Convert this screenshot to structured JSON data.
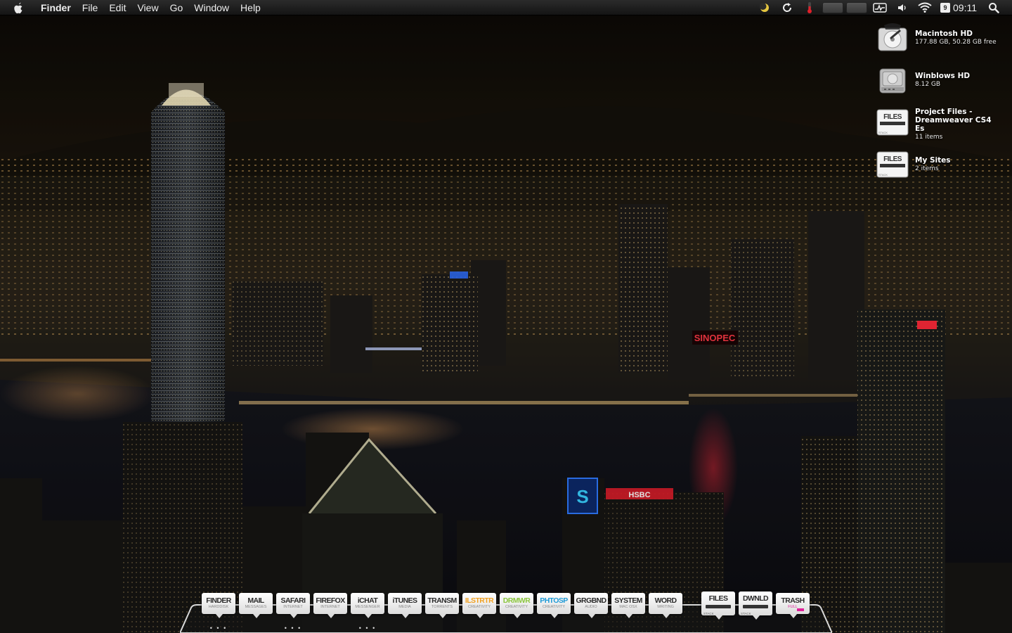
{
  "menubar": {
    "app_name": "Finder",
    "menus": [
      "File",
      "Edit",
      "View",
      "Go",
      "Window",
      "Help"
    ],
    "clock": "09:11",
    "calendar_day": "9",
    "status_icons": [
      "moon-icon",
      "sync-icon",
      "temperature-meter",
      "cpu-meter",
      "memory-meter",
      "activity-monitor-icon",
      "volume-icon",
      "wifi-icon",
      "calendar-icon",
      "spotlight-icon"
    ]
  },
  "desktop_icons": [
    {
      "name": "Macintosh HD",
      "info": "177.88 GB, 50.28 GB free",
      "icon": "hard-drive-icon"
    },
    {
      "name": "Winblows HD",
      "info": "8.12 GB",
      "icon": "hard-drive-icon"
    },
    {
      "name_line1": "Project Files -",
      "name_line2": "Dreamweaver CS4 Es",
      "info": "11 items",
      "icon": "files-stack-icon",
      "label": "FILES",
      "sublabel": "STACK"
    },
    {
      "name": "My Sites",
      "info": "2 items",
      "icon": "files-stack-icon",
      "label": "FILES",
      "sublabel": "STACK"
    }
  ],
  "dock": {
    "apps": [
      {
        "label": "FINDER",
        "sub": "HARDDISK",
        "color": "#2a2a2a",
        "running": true
      },
      {
        "label": "MAIL",
        "sub": "MESSAGES",
        "color": "#2a2a2a",
        "running": false
      },
      {
        "label": "SAFARI",
        "sub": "INTERNET",
        "color": "#2a2a2a",
        "running": true
      },
      {
        "label": "FIREFOX",
        "sub": "INTERNET",
        "color": "#2a2a2a",
        "running": false
      },
      {
        "label": "iCHAT",
        "sub": "MESSENGER",
        "color": "#2a2a2a",
        "running": true
      },
      {
        "label": "iTUNES",
        "sub": "MEDIA",
        "color": "#2a2a2a",
        "running": false
      },
      {
        "label": "TRANSM",
        "sub": "TORRENTS",
        "color": "#2a2a2a",
        "running": false
      },
      {
        "label": "ILSTRTR",
        "sub": "CREATIVITY",
        "color": "#f0a020",
        "running": false
      },
      {
        "label": "DRMWR",
        "sub": "CREATIVITY",
        "color": "#8cc63f",
        "running": false
      },
      {
        "label": "PHTOSP",
        "sub": "CREATIVITY",
        "color": "#1e9ad6",
        "running": false
      },
      {
        "label": "GRGBND",
        "sub": "AUDIO",
        "color": "#2a2a2a",
        "running": false
      },
      {
        "label": "SYSTEM",
        "sub": "MAC OSX",
        "color": "#2a2a2a",
        "running": false
      },
      {
        "label": "WORD",
        "sub": "WRITING",
        "color": "#2a2a2a",
        "running": false
      }
    ],
    "stacks": [
      {
        "label": "FILES",
        "sub": "STACK"
      },
      {
        "label": "DWNLD",
        "sub": "STACK"
      }
    ],
    "trash": {
      "label": "TRASH",
      "sub": "FULL",
      "accent": "#e0209a"
    },
    "running_indicator": "• • •"
  }
}
